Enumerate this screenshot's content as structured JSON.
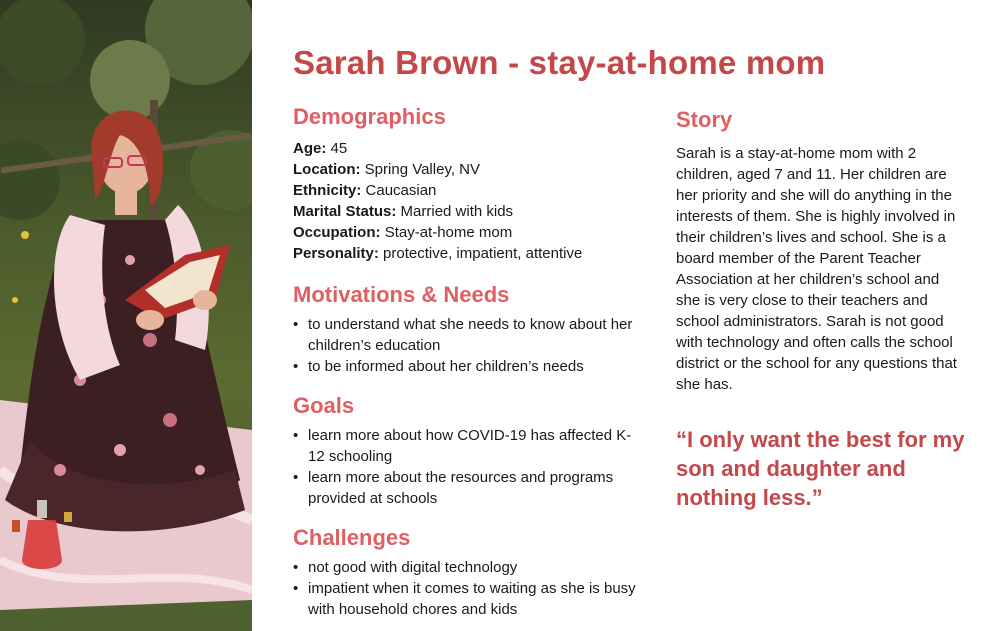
{
  "title": "Sarah Brown - stay-at-home mom",
  "photo": {
    "icon": "persona-photo-reading-icon"
  },
  "demographics": {
    "heading": "Demographics",
    "fields": [
      {
        "label": "Age:",
        "value": "45"
      },
      {
        "label": "Location:",
        "value": "Spring Valley, NV"
      },
      {
        "label": "Ethnicity:",
        "value": "Caucasian"
      },
      {
        "label": "Marital Status:",
        "value": "Married with kids"
      },
      {
        "label": "Occupation:",
        "value": "Stay-at-home mom"
      },
      {
        "label": "Personality:",
        "value": "protective, impatient, attentive"
      }
    ]
  },
  "motivations": {
    "heading": "Motivations & Needs",
    "items": [
      "to understand what she needs to know about her children’s education",
      "to be informed about her children’s needs"
    ]
  },
  "goals": {
    "heading": "Goals",
    "items": [
      "learn more about how COVID-19 has affected K-12 schooling",
      "learn more about the resources and programs provided at schools"
    ]
  },
  "challenges": {
    "heading": "Challenges",
    "items": [
      "not good with digital technology",
      "impatient when it comes to waiting as she is busy with household chores and kids"
    ]
  },
  "story": {
    "heading": "Story",
    "text": "Sarah is a stay-at-home mom with 2 children, aged 7 and 11. Her children are her priority and she will do anything in the interests of them. She is highly involved in their children’s lives and school. She is a board member of the Parent Teacher Association at her children’s school and she is very close to their teachers and school administrators. Sarah is not good with technology and often calls the school district or the school for any questions that she has."
  },
  "quote": "“I only want the best for my son and daughter and nothing less.”",
  "colors": {
    "heading": "#e05f62",
    "title": "#c4474a",
    "text": "#1a1a1a"
  }
}
